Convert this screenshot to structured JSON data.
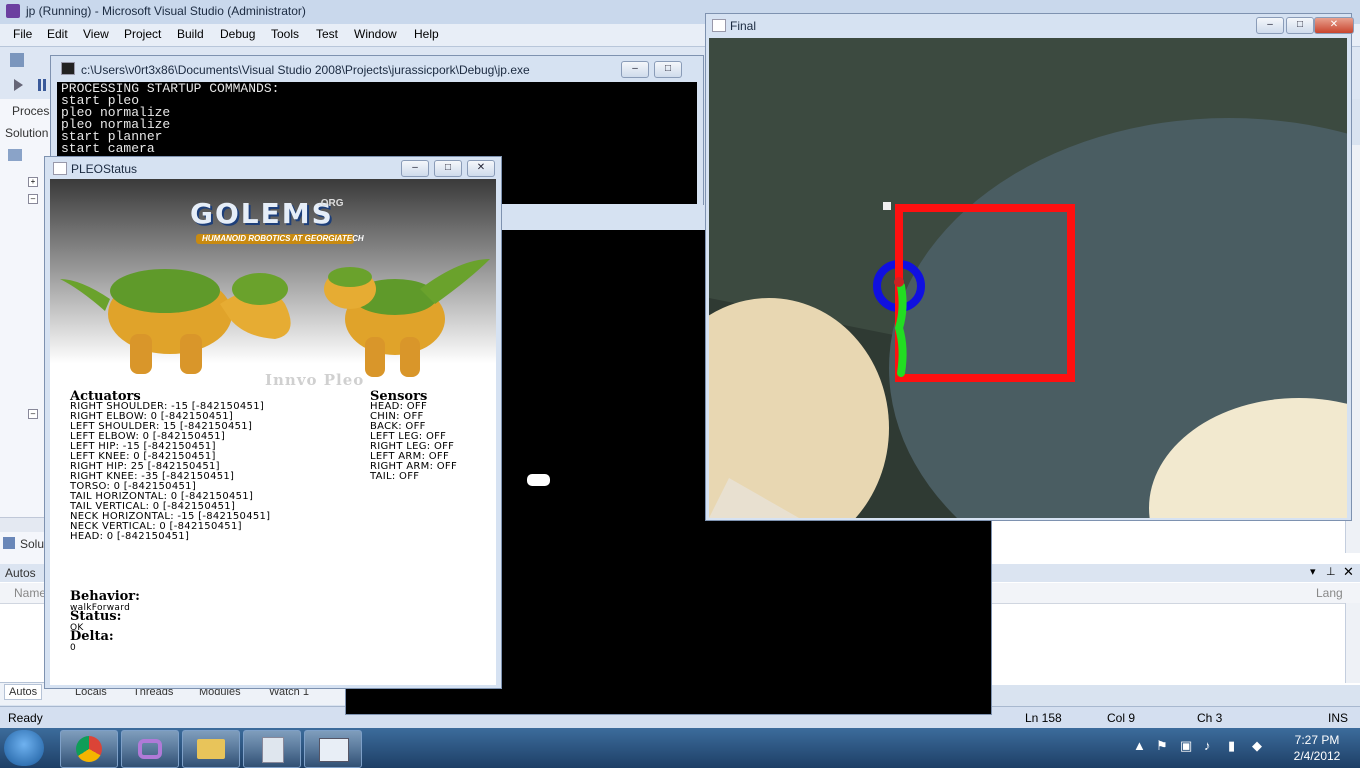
{
  "vs": {
    "title": "jp (Running) - Microsoft Visual Studio (Administrator)",
    "menu": [
      "File",
      "Edit",
      "View",
      "Project",
      "Build",
      "Debug",
      "Tools",
      "Test",
      "Window",
      "Help"
    ],
    "left_panel_labels": {
      "process": "Process",
      "solution": "Solution",
      "solu": "Solu"
    },
    "autos": {
      "title": "Autos",
      "name_col": "Name",
      "lang_col": "Lang"
    },
    "bottom_tabs": [
      "Autos",
      "Locals",
      "Threads",
      "Modules",
      "Watch 1"
    ],
    "status": {
      "ready": "Ready",
      "ln": "Ln 158",
      "col": "Col 9",
      "ch": "Ch 3",
      "ins": "INS"
    }
  },
  "console": {
    "title": "c:\\Users\\v0rt3x86\\Documents\\Visual Studio 2008\\Projects\\jurassicpork\\Debug\\jp.exe",
    "lines": [
      "PROCESSING STARTUP COMMANDS:",
      "start pleo",
      "pleo normalize",
      "pleo normalize",
      "start planner",
      "start camera"
    ]
  },
  "pleo": {
    "title": "PLEOStatus",
    "banner": {
      "logo": "GOLEMS",
      "org": ".ORG",
      "tagline": "HUMANOID ROBOTICS AT GEORGIATECH",
      "watermark": "Innvo Pleo"
    },
    "actuators_heading": "Actuators",
    "actuators": [
      "RIGHT SHOULDER: -15 [-842150451]",
      "RIGHT ELBOW: 0 [-842150451]",
      "LEFT SHOULDER: 15 [-842150451]",
      "LEFT ELBOW: 0 [-842150451]",
      "LEFT HIP: -15 [-842150451]",
      "LEFT KNEE: 0 [-842150451]",
      "RIGHT HIP: 25 [-842150451]",
      "RIGHT KNEE: -35 [-842150451]",
      "TORSO: 0 [-842150451]",
      "TAIL HORIZONTAL: 0 [-842150451]",
      "TAIL VERTICAL: 0 [-842150451]",
      "NECK HORIZONTAL: -15 [-842150451]",
      "NECK VERTICAL: 0 [-842150451]",
      "HEAD: 0 [-842150451]"
    ],
    "sensors_heading": "Sensors",
    "sensors": [
      "HEAD: OFF",
      "CHIN: OFF",
      "BACK: OFF",
      "LEFT LEG: OFF",
      "RIGHT LEG: OFF",
      "LEFT ARM: OFF",
      "RIGHT ARM: OFF",
      "TAIL: OFF"
    ],
    "behavior_label": "Behavior:",
    "behavior_value": "walkForward",
    "status_label": "Status:",
    "status_value": "OK",
    "delta_label": "Delta:",
    "delta_value": "0"
  },
  "final": {
    "title": "Final"
  },
  "window_buttons": {
    "min": "–",
    "max": "□",
    "close": "✕"
  },
  "taskbar": {
    "time": "7:27 PM",
    "date": "2/4/2012"
  },
  "colors": {
    "tracker_box": "#ff1010",
    "tracker_circle": "#1010e0",
    "trail": "#22dd22"
  }
}
